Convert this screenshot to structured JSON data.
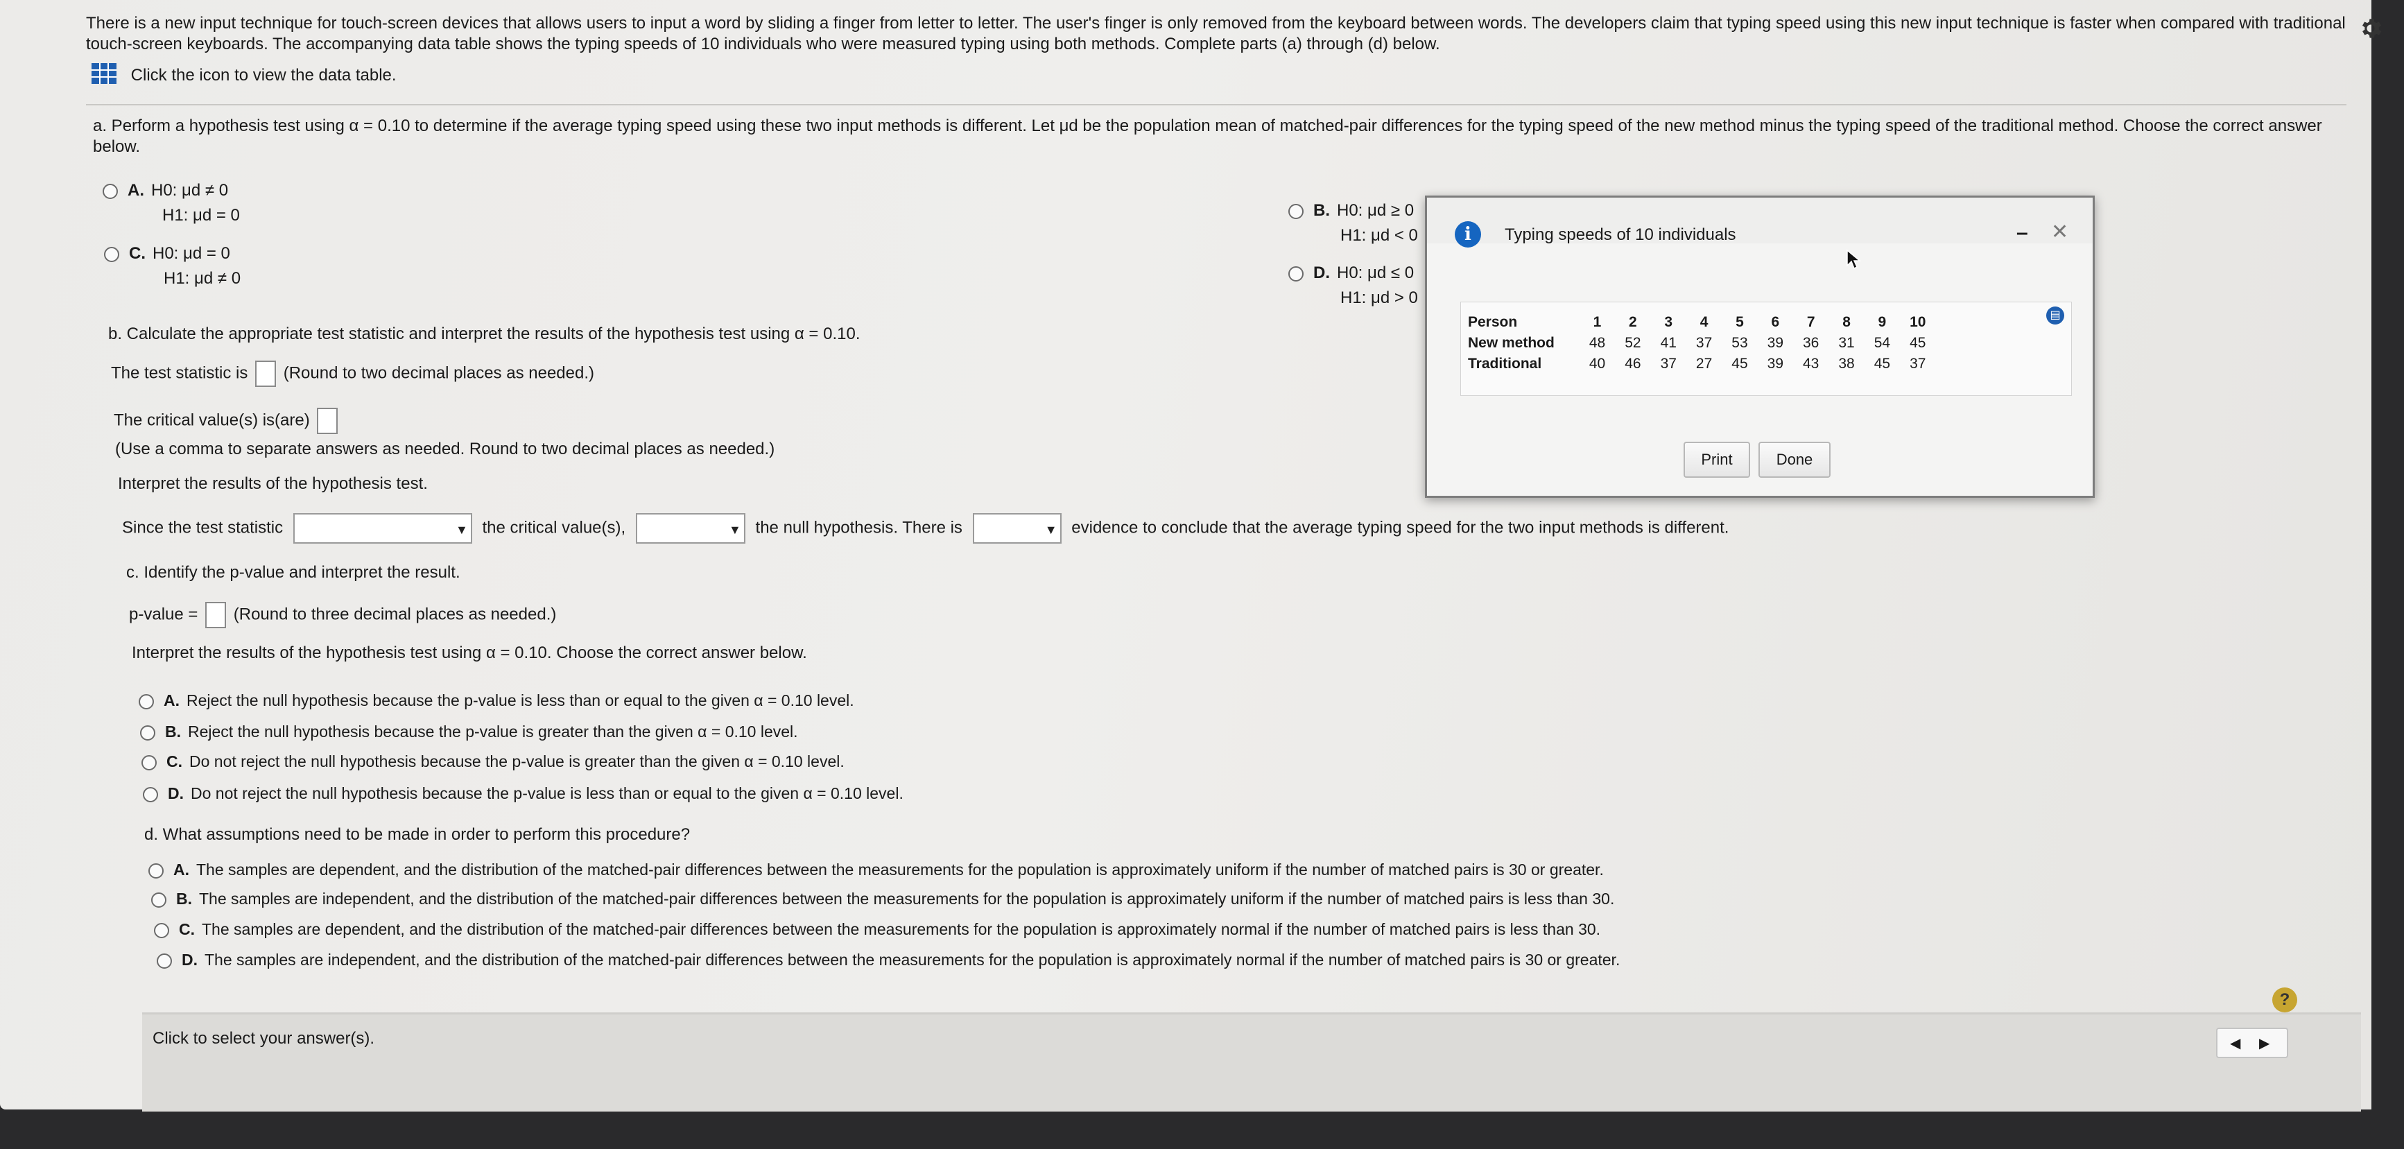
{
  "intro": {
    "line1": "There is a new input technique for touch-screen devices that allows users to input a word by sliding a finger from letter to letter. The user's finger is only removed from the keyboard between words. The developers claim that typing speed using this new input technique is faster when compared with traditional",
    "line2": "touch-screen keyboards. The accompanying data table shows the typing speeds of 10 individuals who were measured typing using both methods. Complete parts (a) through (d) below.",
    "data_link": "Click the icon to view the data table."
  },
  "part_a": {
    "prompt1": "a. Perform a hypothesis test using α = 0.10 to determine if the average typing speed using these two input methods is different. Let μd be the population mean of matched-pair differences for the typing speed of the new method minus the typing speed of the traditional method. Choose the correct answer",
    "prompt2": "below.",
    "options": [
      {
        "letter": "A.",
        "h0": "H0: μd ≠ 0",
        "h1": "H1: μd = 0"
      },
      {
        "letter": "B.",
        "h0": "H0: μd ≥ 0",
        "h1": "H1: μd < 0"
      },
      {
        "letter": "C.",
        "h0": "H0: μd = 0",
        "h1": "H1: μd ≠ 0"
      },
      {
        "letter": "D.",
        "h0": "H0: μd ≤ 0",
        "h1": "H1: μd > 0"
      }
    ]
  },
  "part_b": {
    "prompt": "b. Calculate the appropriate test statistic and interpret the results of the hypothesis test using α = 0.10.",
    "stat_label": "The test statistic is",
    "stat_note": "(Round to two decimal places as needed.)",
    "crit_label": "The critical value(s) is(are)",
    "crit_note": "(Use a comma to separate answers as needed. Round to two decimal places as needed.)",
    "interpret": "Interpret the results of the hypothesis test.",
    "since": "Since the test statistic",
    "the_crit": "the critical value(s),",
    "null_there": "the null hypothesis. There is",
    "evidence": "evidence to conclude that the average typing speed for the two input methods is different."
  },
  "part_c": {
    "prompt": "c. Identify the p-value and interpret the result.",
    "pvalue_label": "p-value =",
    "pvalue_note": "(Round to three decimal places as needed.)",
    "interpret": "Interpret the results of the hypothesis test using α = 0.10. Choose the correct answer below.",
    "options": [
      {
        "letter": "A.",
        "text": "Reject the null hypothesis because the p-value is less than or equal to the given α = 0.10 level."
      },
      {
        "letter": "B.",
        "text": "Reject the null hypothesis because the p-value is greater than the given α = 0.10 level."
      },
      {
        "letter": "C.",
        "text": "Do not reject the null hypothesis because the p-value is greater than the given α = 0.10 level."
      },
      {
        "letter": "D.",
        "text": "Do not reject the null hypothesis because the p-value is less than or equal to the given α = 0.10 level."
      }
    ]
  },
  "part_d": {
    "prompt": "d. What assumptions need to be made in order to perform this procedure?",
    "options": [
      {
        "letter": "A.",
        "text": "The samples are dependent, and the distribution of the matched-pair differences between the measurements for the population is approximately uniform if the number of matched pairs is 30 or greater."
      },
      {
        "letter": "B.",
        "text": "The samples are independent, and the distribution of the matched-pair differences between the measurements for the population is approximately uniform if the number of matched pairs is less than 30."
      },
      {
        "letter": "C.",
        "text": "The samples are dependent, and the distribution of the matched-pair differences between the measurements for the population is approximately normal if the number of matched pairs is less than 30."
      },
      {
        "letter": "D.",
        "text": "The samples are independent, and the distribution of the matched-pair differences between the measurements for the population is approximately normal if the number of matched pairs is 30 or greater."
      }
    ]
  },
  "footer": {
    "status": "Click to select your answer(s).",
    "help": "?"
  },
  "popup": {
    "title": "Typing speeds of 10 individuals",
    "minimize": "–",
    "close": "✕",
    "info": "i",
    "table": {
      "row_labels": [
        "Person",
        "New method",
        "Traditional"
      ],
      "persons": [
        "1",
        "2",
        "3",
        "4",
        "5",
        "6",
        "7",
        "8",
        "9",
        "10"
      ],
      "new_method": [
        "48",
        "52",
        "41",
        "37",
        "53",
        "39",
        "36",
        "31",
        "54",
        "45"
      ],
      "traditional": [
        "40",
        "46",
        "37",
        "27",
        "45",
        "39",
        "43",
        "38",
        "45",
        "37"
      ]
    },
    "print_label": "Print",
    "done_label": "Done"
  },
  "colors": {
    "info_blue": "#1565c0",
    "grid_blue": "#1f5fb0"
  }
}
